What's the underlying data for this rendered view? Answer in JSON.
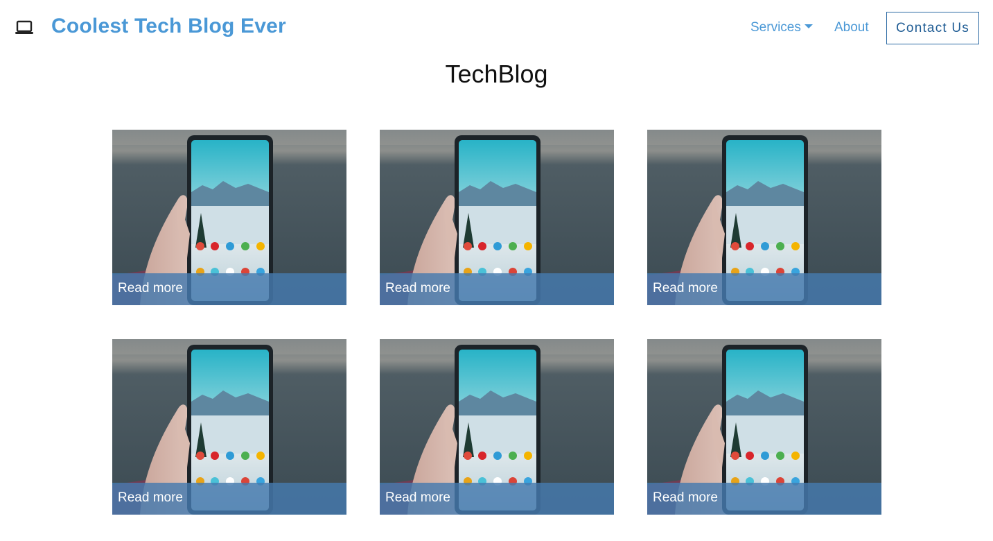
{
  "nav": {
    "brand_icon": "laptop-icon",
    "brand_title": "Coolest Tech Blog Ever",
    "services_label": "Services",
    "services_icon": "caret-down-icon",
    "about_label": "About",
    "contact_label": "Contact Us"
  },
  "main": {
    "title": "TechBlog",
    "cards": [
      {
        "label": "Read more",
        "image": "phone-in-hand-photo"
      },
      {
        "label": "Read more",
        "image": "phone-in-hand-photo"
      },
      {
        "label": "Read more",
        "image": "phone-in-hand-photo"
      },
      {
        "label": "Read more",
        "image": "phone-in-hand-photo"
      },
      {
        "label": "Read more",
        "image": "phone-in-hand-photo"
      },
      {
        "label": "Read more",
        "image": "phone-in-hand-photo"
      }
    ]
  },
  "colors": {
    "brand": "#4a98d6",
    "contact_border": "#2c6aa3",
    "overlay": "#467aaf",
    "background": "#ffffff"
  }
}
